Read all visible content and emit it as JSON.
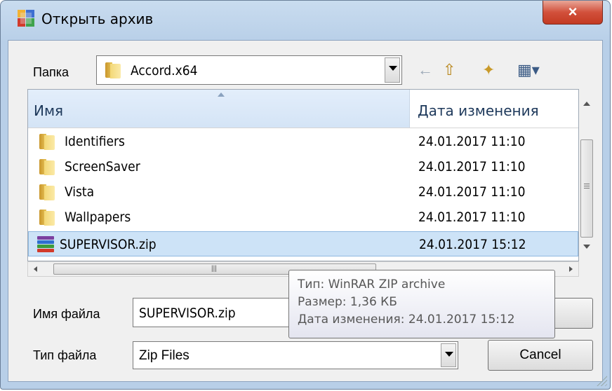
{
  "window": {
    "title": "Открыть архив",
    "close_icon": "×"
  },
  "folder_bar": {
    "label": "Папка",
    "current_folder": "Accord.x64"
  },
  "toolbar": {
    "back_icon": "←",
    "up_icon": "⇧",
    "new_folder_icon": "✦",
    "view_icon": "▦▾"
  },
  "file_list": {
    "columns": [
      "Имя",
      "Дата изменения"
    ],
    "rows": [
      {
        "name": "Identifiers",
        "date": "24.01.2017 11:10",
        "type": "folder"
      },
      {
        "name": "ScreenSaver",
        "date": "24.01.2017 11:10",
        "type": "folder"
      },
      {
        "name": "Vista",
        "date": "24.01.2017 11:10",
        "type": "folder"
      },
      {
        "name": "Wallpapers",
        "date": "24.01.2017 11:10",
        "type": "folder"
      },
      {
        "name": "SUPERVISOR.zip",
        "date": "24.01.2017 15:12",
        "type": "zip",
        "selected": true
      }
    ]
  },
  "tooltip": {
    "type_line": "Тип: WinRAR ZIP archive",
    "size_line": "Размер: 1,36 КБ",
    "date_line": "Дата изменения: 24.01.2017 15:12"
  },
  "filename": {
    "label": "Имя файла",
    "value": "SUPERVISOR.zip"
  },
  "filetype": {
    "label": "Тип файла",
    "value": "Zip Files"
  },
  "buttons": {
    "open_label": "",
    "cancel_label": "Cancel"
  },
  "colors": {
    "selection": "#cde3f7",
    "close_button": "#c33a22",
    "accent": "#1e395b"
  }
}
